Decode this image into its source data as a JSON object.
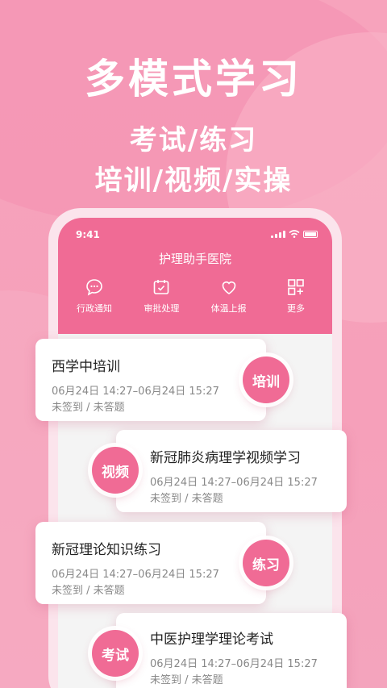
{
  "hero": {
    "title": "多模式学习",
    "line1": "考试/练习",
    "line2": "培训/视频/实操"
  },
  "status_bar": {
    "time": "9:41"
  },
  "app": {
    "title": "护理助手医院"
  },
  "quick_actions": [
    {
      "label": "行政通知",
      "icon": "chat-bubble-icon"
    },
    {
      "label": "审批处理",
      "icon": "calendar-check-icon"
    },
    {
      "label": "体温上报",
      "icon": "heart-icon"
    },
    {
      "label": "更多",
      "icon": "grid-plus-icon"
    }
  ],
  "cards": [
    {
      "title": "西学中培训",
      "time": "06月24日 14:27–06月24日 15:27",
      "status": "未签到 / 未答题",
      "badge": "培训"
    },
    {
      "title": "新冠肺炎病理学视频学习",
      "time": "06月24日 14:27–06月24日 15:27",
      "status": "未签到 / 未答题",
      "badge": "视频"
    },
    {
      "title": "新冠理论知识练习",
      "time": "06月24日 14:27–06月24日 15:27",
      "status": "未签到 / 未答题",
      "badge": "练习"
    },
    {
      "title": "中医护理学理论考试",
      "time": "06月24日 14:27–06月24日 15:27",
      "status": "未签到 / 未答题",
      "badge": "考试"
    }
  ],
  "colors": {
    "brand": "#f06b95",
    "background": "#f7a3bc"
  }
}
